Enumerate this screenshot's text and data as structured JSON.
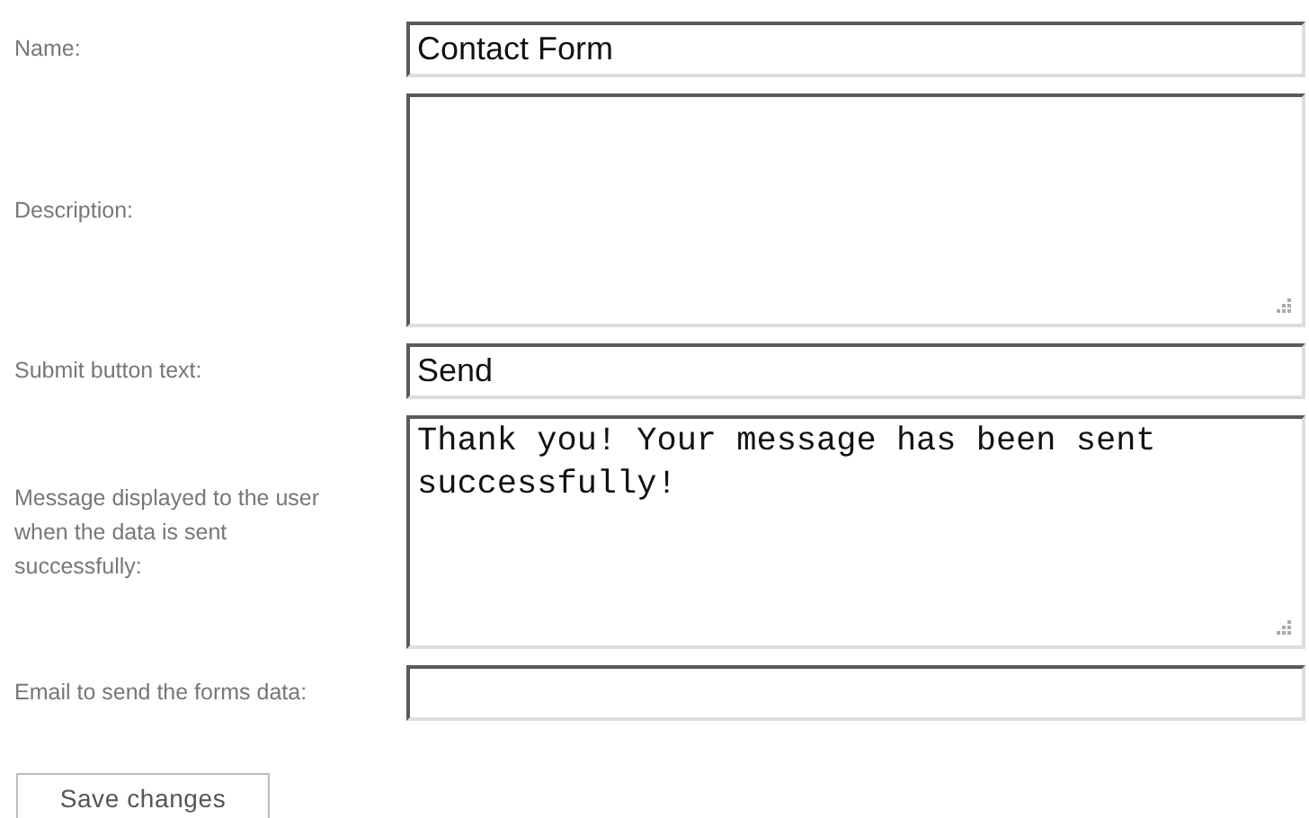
{
  "fields": [
    {
      "label": "Name:",
      "kind": "text",
      "value": "Contact Form"
    },
    {
      "label": "Description:",
      "kind": "textarea"
    },
    {
      "label": "Submit button text:",
      "kind": "text",
      "value": "Send"
    },
    {
      "label": "Message displayed to the user when the data is sent successfully:",
      "kind": "textarea",
      "value": "Thank you! Your message has been sent successfully!"
    },
    {
      "label": "Email to send the forms data:",
      "kind": "text"
    }
  ],
  "save_button": "Save changes"
}
